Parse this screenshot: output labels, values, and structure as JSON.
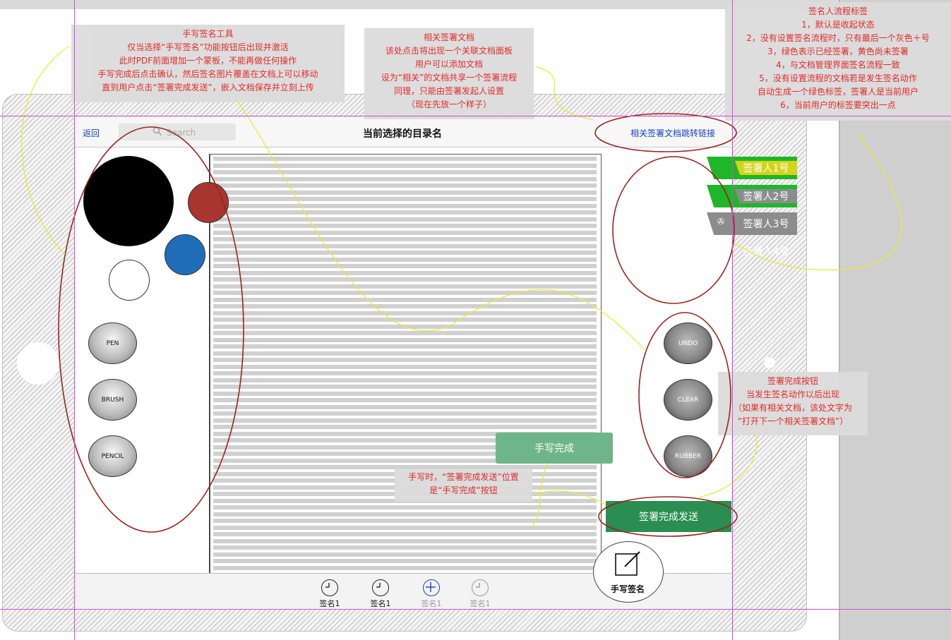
{
  "navbar": {
    "back_label": "返回",
    "search_placeholder": "Search",
    "title": "当前选择的目录名",
    "related_link": "相关签署文档跳转链接"
  },
  "palette": {
    "colors": [
      "#000000",
      "#a8352f",
      "#1f6db9",
      "#ffffff"
    ]
  },
  "left_tools": [
    "PEN",
    "BRUSH",
    "PENCIL"
  ],
  "right_tools": [
    "UNDO",
    "CLEAR",
    "RUBBER"
  ],
  "signers": [
    {
      "label": "签署人1号",
      "color": "#1fb62a",
      "status": "signed"
    },
    {
      "label": "签署人2号",
      "color": "#d4d41b",
      "status": "pending"
    },
    {
      "label": "签署人3号",
      "color": "#1fb62a",
      "status": "signed",
      "icon": "✇"
    },
    {
      "label": "签署人4号",
      "color": "#8c8c8c",
      "status": "default"
    },
    {
      "label": "",
      "color": "#8c8c8c",
      "status": "add",
      "icon": "plus-circle-icon"
    }
  ],
  "buttons": {
    "handwrite_done": "手写完成",
    "sign_complete_send": "签署完成发送",
    "handwrite_sign": "手写签名"
  },
  "tabs": [
    {
      "label": "签名1",
      "icon": "clock-icon",
      "active": true
    },
    {
      "label": "签名1",
      "icon": "clock-icon",
      "active": true
    },
    {
      "label": "签名1",
      "icon": "plus-circle-icon",
      "active": false
    },
    {
      "label": "签名1",
      "icon": "clock-icon",
      "active": false
    }
  ],
  "notes": {
    "handwrite_tool": [
      "手写签名工具",
      "仅当选择“手写签名”功能按钮后出现并激活",
      "此时PDF前面增加一个蒙板，不能再做任何操作",
      "手写完成后点击确认，然后签名图片覆盖在文档上可以移动",
      "直到用户点击“签署完成发送”，嵌入文档保存并立刻上传"
    ],
    "related_docs": [
      "相关签署文档",
      "该处点击将出现一个关联文档面板",
      "用户可以添加文档",
      "设为“相关”的文档共享一个签署流程",
      "同理，只能由签署发起人设置",
      "（现在先放一个样子）"
    ],
    "signer_tags": [
      "签名人流程标签",
      "1，默认是收起状态",
      "2，没有设置签名流程时，只有最后一个灰色＋号",
      "3，绿色表示已经签署，黄色尚未签署",
      "4，与文档管理界面签名流程一致",
      "5，没有设置流程的文档若是发生签名动作",
      "自动生成一个绿色标签，签署人是当前用户",
      "6，当前用户的标签要突出一点"
    ],
    "complete_button": [
      "签署完成按钮",
      "当发生签名动作以后出现",
      "（如果有相关文档，该处文字为",
      "“打开下一个相关签署文档”）"
    ],
    "handwrite_hint": [
      "手写时，“签署完成发送”位置",
      "是“手写完成”按钮"
    ]
  }
}
